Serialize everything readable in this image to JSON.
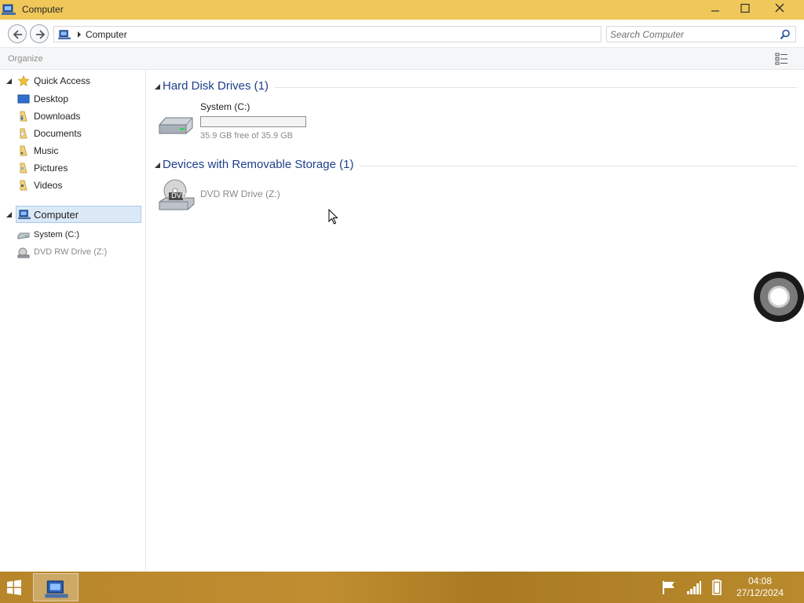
{
  "window": {
    "title": "Computer",
    "controls": {
      "minimize": "minimize",
      "maximize": "maximize",
      "close": "close"
    }
  },
  "address_bar": {
    "path": "Computer",
    "search_placeholder": "Search Computer"
  },
  "command_bar": {
    "organize_label": "Organize"
  },
  "nav_pane": {
    "quick_access": {
      "label": "Quick Access",
      "items": [
        {
          "label": "Desktop",
          "icon": "desktop-icon"
        },
        {
          "label": "Downloads",
          "icon": "downloads-folder-icon"
        },
        {
          "label": "Documents",
          "icon": "documents-folder-icon"
        },
        {
          "label": "Music",
          "icon": "music-folder-icon"
        },
        {
          "label": "Pictures",
          "icon": "pictures-folder-icon"
        },
        {
          "label": "Videos",
          "icon": "videos-folder-icon"
        }
      ]
    },
    "computer": {
      "label": "Computer",
      "items": [
        {
          "label": "System (C:)",
          "icon": "hard-drive-icon"
        },
        {
          "label": "DVD RW Drive (Z:)",
          "icon": "dvd-drive-icon"
        }
      ]
    }
  },
  "content": {
    "groups": [
      {
        "title": "Hard Disk Drives (1)",
        "drive": {
          "name": "System (C:)",
          "info": "35.9 GB free of 35.9 GB",
          "used_fraction": 0.0
        }
      },
      {
        "title": "Devices with Removable Storage (1)",
        "drive": {
          "name": "DVD RW Drive (Z:)",
          "badge": "DVD"
        }
      }
    ]
  },
  "taskbar": {
    "pinned_app": "computer-icon",
    "tray_icons": [
      "action-center-flag-icon",
      "network-signal-icon",
      "battery-icon"
    ],
    "time": "04:08",
    "date": "27/12/2024"
  },
  "colors": {
    "titlebar": "#f0c85a",
    "taskbar": "#b8862a",
    "group_header_text": "#1e3f8a",
    "selection": "#dbe9f7"
  }
}
